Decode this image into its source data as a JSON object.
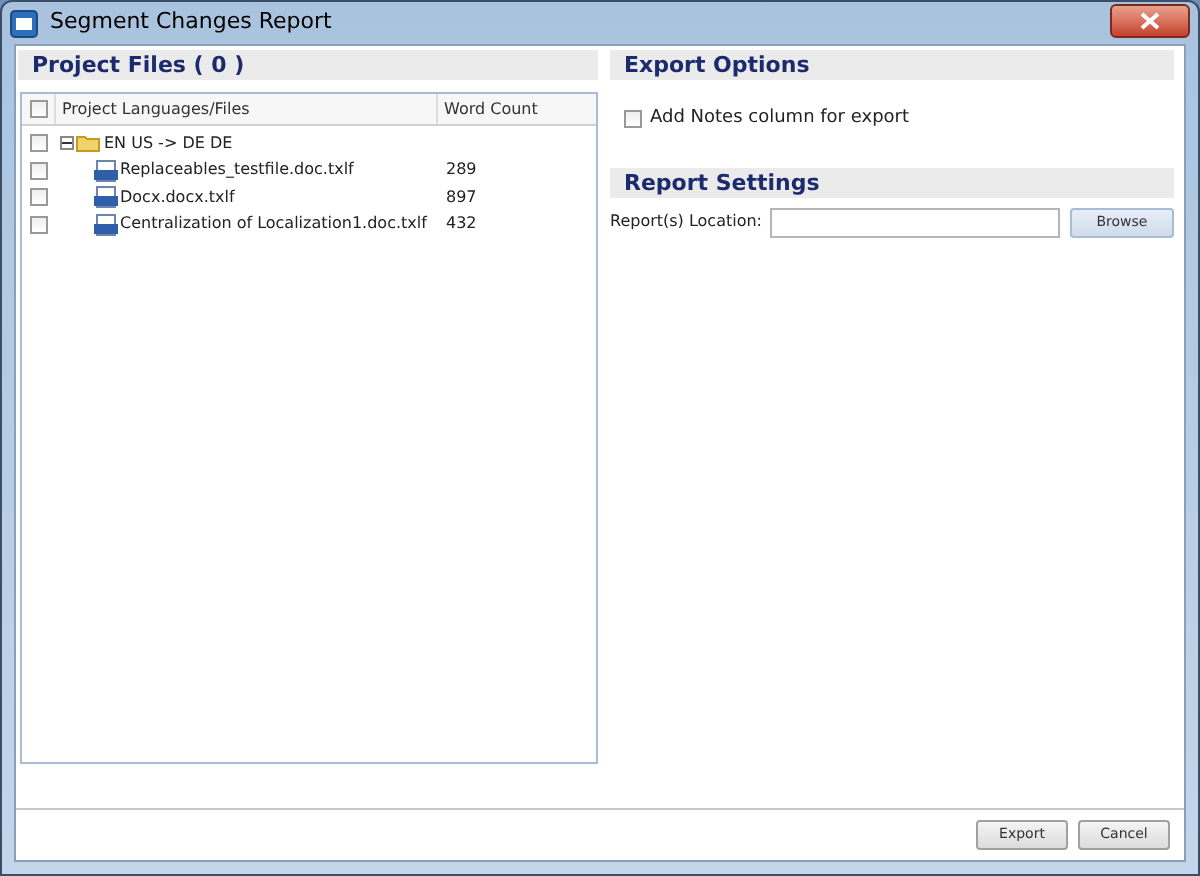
{
  "window": {
    "title": "Segment Changes Report"
  },
  "project_files": {
    "title": "Project Files ( 0 )",
    "select_all_checked": false,
    "columns": [
      "Project Languages/Files",
      "Word Count"
    ],
    "tree": [
      {
        "label": "EN US -> DE DE",
        "checked": false,
        "expanded": true,
        "children": [
          {
            "label": "Replaceables_testfile.doc.txlf",
            "word_count": "289",
            "checked": false
          },
          {
            "label": "Docx.docx.txlf",
            "word_count": "897",
            "checked": false
          },
          {
            "label": "Centralization of Localization1.doc.txlf",
            "word_count": "432",
            "checked": false
          }
        ]
      }
    ]
  },
  "export_options": {
    "title": "Export Options",
    "add_notes": {
      "label": "Add Notes column for export",
      "checked": false
    }
  },
  "report_settings": {
    "title": "Report Settings",
    "location_label": "Report(s) Location:",
    "browse": "Browse"
  },
  "buttons": [
    "Export",
    "Cancel"
  ]
}
